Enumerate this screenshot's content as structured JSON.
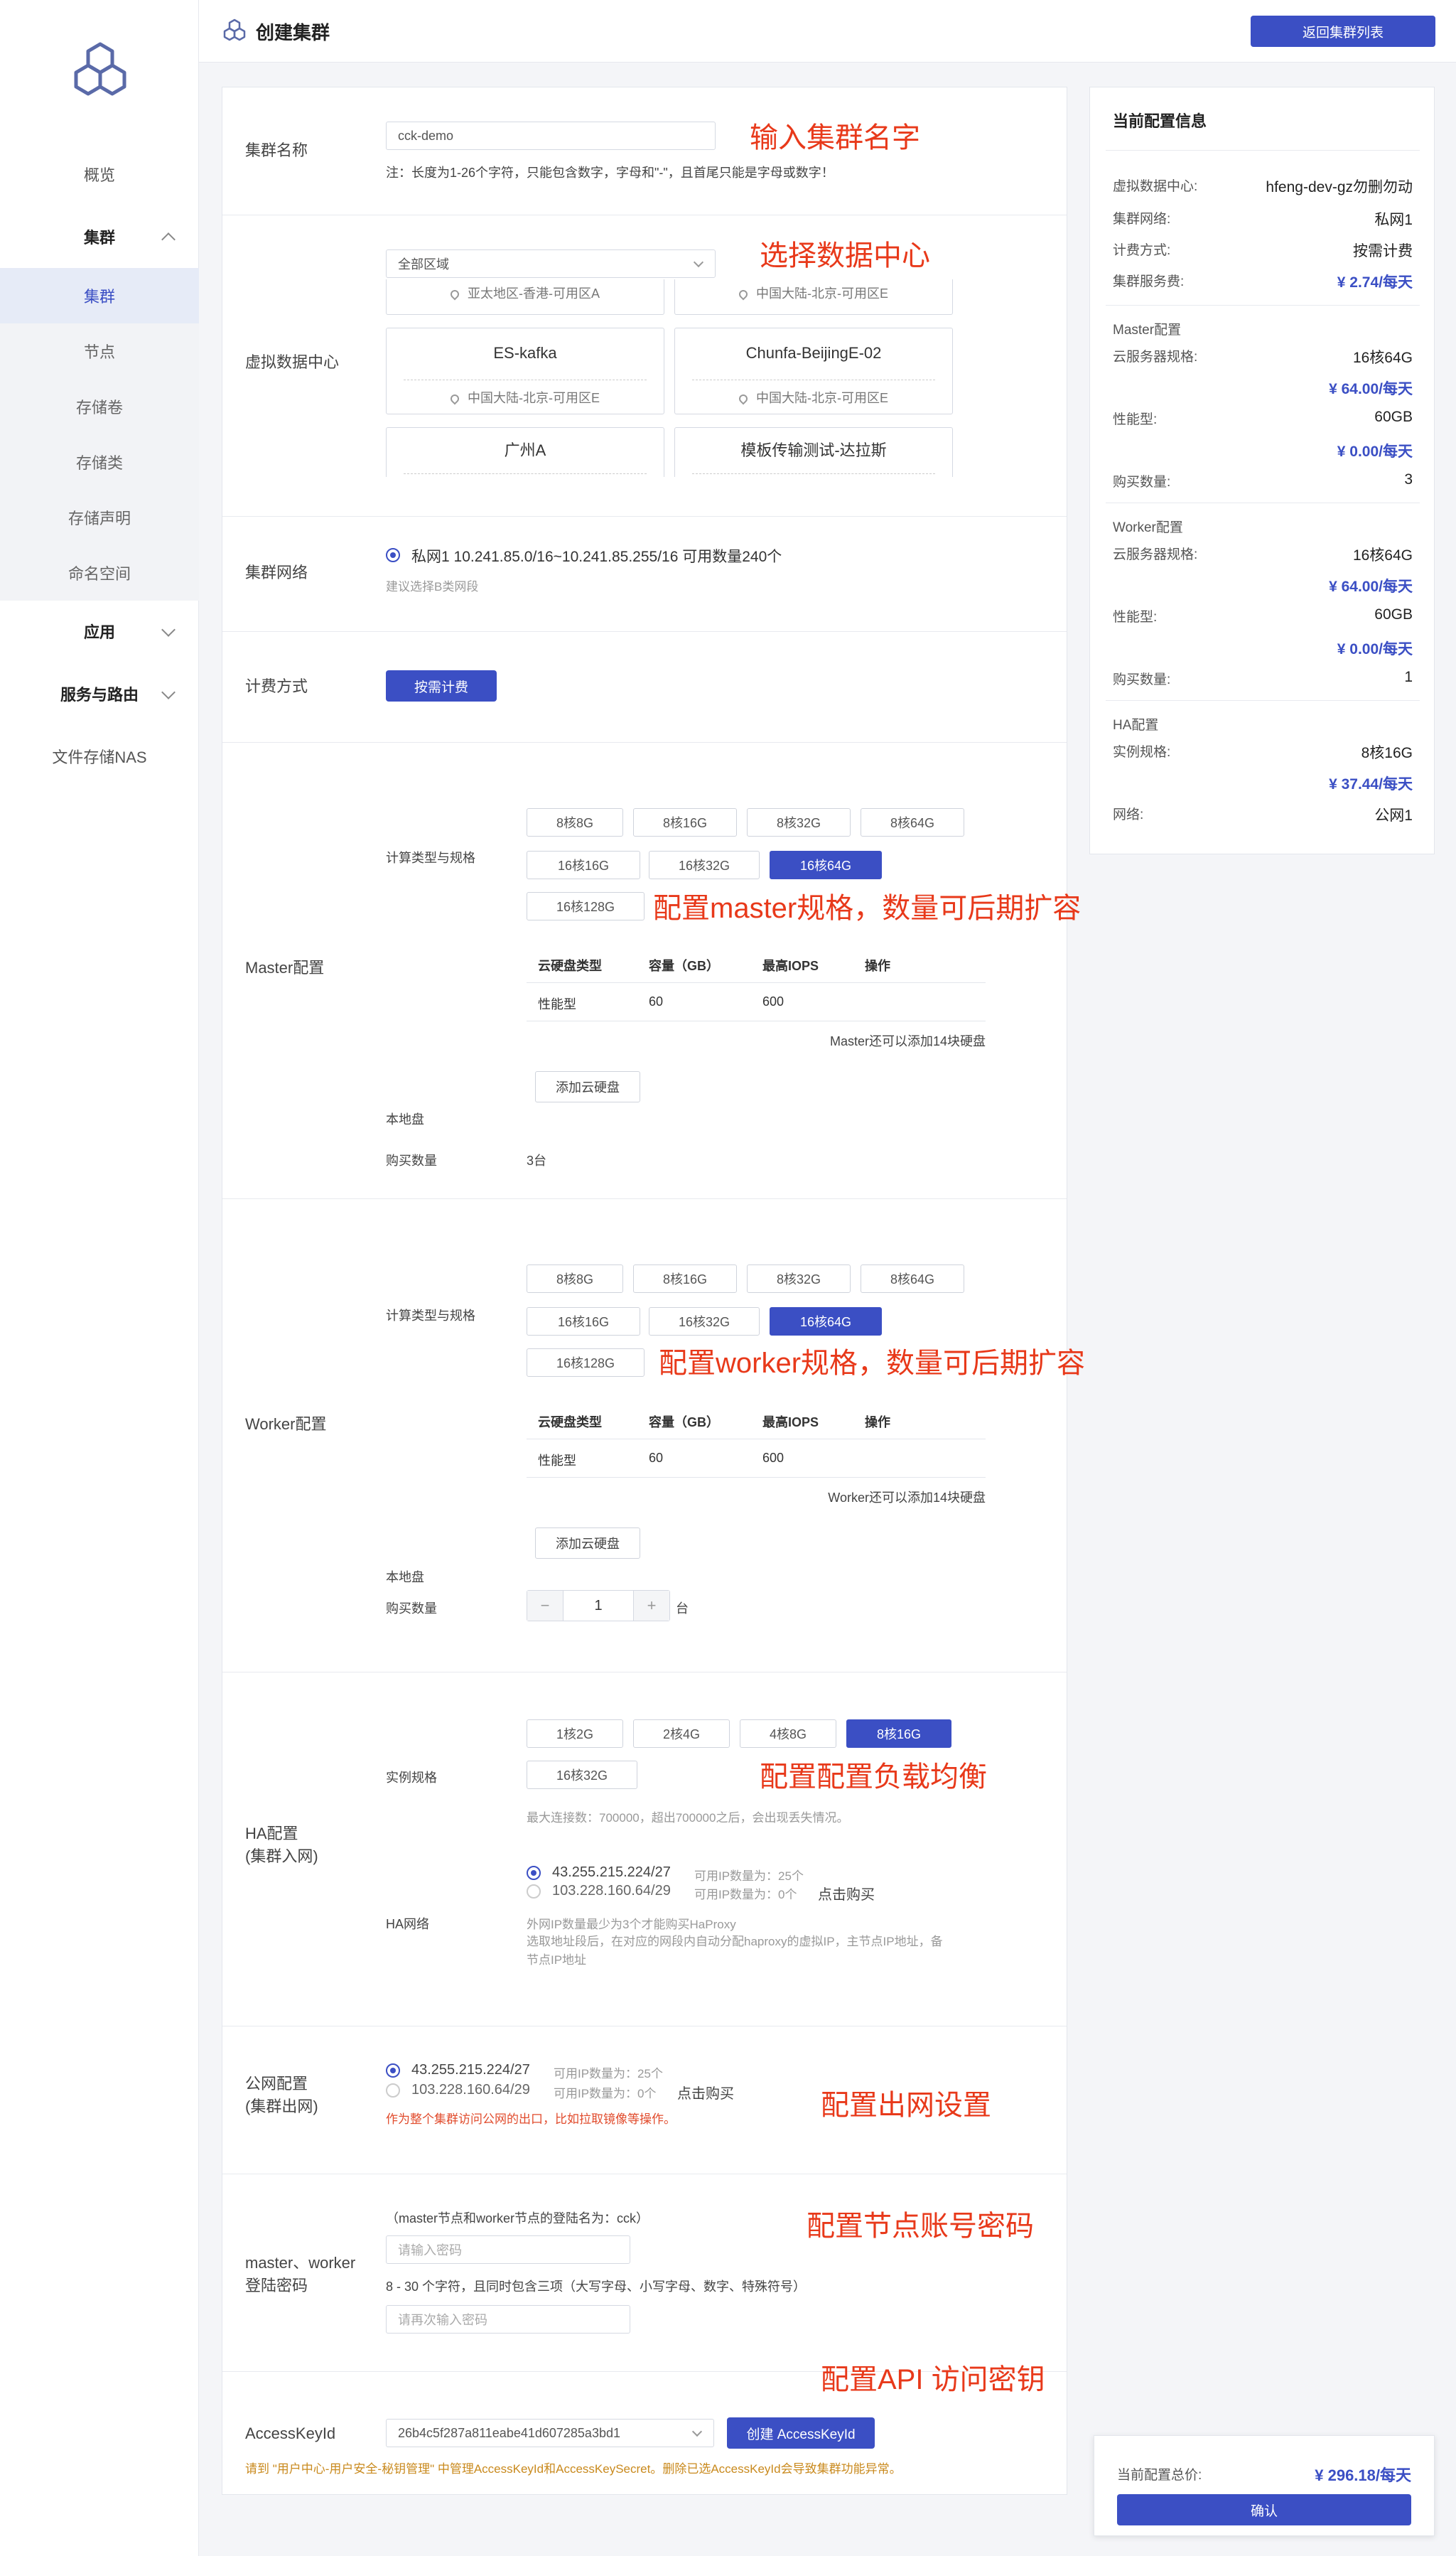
{
  "sidebar": {
    "items": [
      {
        "label": "概览"
      },
      {
        "label": "集群"
      },
      {
        "label": "集群"
      },
      {
        "label": "节点"
      },
      {
        "label": "存储卷"
      },
      {
        "label": "存储类"
      },
      {
        "label": "存储声明"
      },
      {
        "label": "命名空间"
      },
      {
        "label": "应用"
      },
      {
        "label": "服务与路由"
      },
      {
        "label": "文件存储NAS"
      }
    ]
  },
  "header": {
    "title": "创建集群",
    "back_button": "返回集群列表"
  },
  "form": {
    "name": {
      "label": "集群名称",
      "value": "cck-demo",
      "hint": "注：长度为1-26个字符，只能包含数字，字母和\"-\"，且首尾只能是字母或数字！",
      "annotation": "输入集群名字"
    },
    "datacenter": {
      "label": "虚拟数据中心",
      "region_select": "全部区域",
      "annotation": "选择数据中心",
      "partial_top": [
        {
          "location": "亚太地区-香港-可用区A"
        },
        {
          "location": "中国大陆-北京-可用区E"
        }
      ],
      "cards": [
        {
          "name": "ES-kafka",
          "location": "中国大陆-北京-可用区E"
        },
        {
          "name": "Chunfa-BeijingE-02",
          "location": "中国大陆-北京-可用区E"
        }
      ],
      "partial_bottom": [
        {
          "name": "广州A"
        },
        {
          "name": "模板传输测试-达拉斯"
        }
      ]
    },
    "network": {
      "label": "集群网络",
      "option": "私网1   10.241.85.0/16~10.241.85.255/16   可用数量240个",
      "hint": "建议选择B类网段"
    },
    "billing": {
      "label": "计费方式",
      "button": "按需计费"
    },
    "master": {
      "label": "Master配置",
      "spec_label": "计算类型与规格",
      "specs": [
        "8核8G",
        "8核16G",
        "8核32G",
        "8核64G",
        "16核16G",
        "16核32G",
        "16核64G",
        "16核128G"
      ],
      "annotation": "配置master规格，数量可后期扩容",
      "disk_label": "本地盘",
      "disk_headers": [
        "云硬盘类型",
        "容量（GB）",
        "最高IOPS",
        "操作"
      ],
      "disk_row": [
        "性能型",
        "60",
        "600",
        ""
      ],
      "disk_note": "Master还可以添加14块硬盘",
      "add_disk": "添加云硬盘",
      "count_label": "购买数量",
      "count_value": "3台"
    },
    "worker": {
      "label": "Worker配置",
      "spec_label": "计算类型与规格",
      "specs": [
        "8核8G",
        "8核16G",
        "8核32G",
        "8核64G",
        "16核16G",
        "16核32G",
        "16核64G",
        "16核128G"
      ],
      "annotation": "配置worker规格，数量可后期扩容",
      "disk_label": "本地盘",
      "disk_headers": [
        "云硬盘类型",
        "容量（GB）",
        "最高IOPS",
        "操作"
      ],
      "disk_row": [
        "性能型",
        "60",
        "600",
        ""
      ],
      "disk_note": "Worker还可以添加14块硬盘",
      "add_disk": "添加云硬盘",
      "count_label": "购买数量",
      "count_value": "1",
      "count_unit": "台",
      "minus": "−",
      "plus": "+"
    },
    "ha": {
      "label_line1": "HA配置",
      "label_line2": "(集群入网)",
      "spec_label": "实例规格",
      "specs": [
        "1核2G",
        "2核4G",
        "4核8G",
        "8核16G",
        "16核32G"
      ],
      "annotation": "配置配置负载均衡",
      "max_conn": "最大连接数：700000，超出700000之后，会出现丢失情况。",
      "net_label": "HA网络",
      "ip1": "43.255.215.224/27",
      "ip1_avail": "可用IP数量为：25个",
      "ip2": "103.228.160.64/29",
      "ip2_avail": "可用IP数量为：0个",
      "buy": "点击购买",
      "note1": "外网IP数量最少为3个才能购买HaProxy",
      "note2": "选取地址段后，在对应的网段内自动分配haproxy的虚拟IP，主节点IP地址，备节点IP地址"
    },
    "public": {
      "label_line1": "公网配置",
      "label_line2": "(集群出网)",
      "ip1": "43.255.215.224/27",
      "ip1_avail": "可用IP数量为：25个",
      "ip2": "103.228.160.64/29",
      "ip2_avail": "可用IP数量为：0个",
      "buy": "点击购买",
      "note": "作为整个集群访问公网的出口，比如拉取镜像等操作。",
      "annotation": "配置出网设置"
    },
    "password": {
      "label_line1": "master、worker",
      "label_line2": "登陆密码",
      "note": "（master节点和worker节点的登陆名为：cck）",
      "placeholder": "请输入密码",
      "rule": "8 - 30 个字符，且同时包含三项（大写字母、小写字母、数字、特殊符号）",
      "placeholder2": "请再次输入密码",
      "annotation": "配置节点账号密码"
    },
    "accesskey": {
      "label": "AccessKeyId",
      "value": "26b4c5f287a811eabe41d607285a3bd1",
      "button": "创建 AccessKeyId",
      "note": "请到 \"用户中心-用户安全-秘钥管理\" 中管理AccessKeyId和AccessKeySecret。删除已选AccessKeyId会导致集群功能异常。",
      "annotation": "配置API 访问密钥"
    }
  },
  "summary": {
    "title": "当前配置信息",
    "vdc_label": "虚拟数据中心:",
    "vdc_value": "hfeng-dev-gz勿删勿动",
    "net_label": "集群网络:",
    "net_value": "私网1",
    "bill_label": "计费方式:",
    "bill_value": "按需计费",
    "fee_label": "集群服务费:",
    "fee_value": "¥ 2.74/每天",
    "master_title": "Master配置",
    "m_spec_label": "云服务器规格:",
    "m_spec_value": "16核64G",
    "m_spec_price": "¥ 64.00/每天",
    "m_perf_label": "性能型:",
    "m_perf_value": "60GB",
    "m_perf_price": "¥ 0.00/每天",
    "m_count_label": "购买数量:",
    "m_count_value": "3",
    "worker_title": "Worker配置",
    "w_spec_label": "云服务器规格:",
    "w_spec_value": "16核64G",
    "w_spec_price": "¥ 64.00/每天",
    "w_perf_label": "性能型:",
    "w_perf_value": "60GB",
    "w_perf_price": "¥ 0.00/每天",
    "w_count_label": "购买数量:",
    "w_count_value": "1",
    "ha_title": "HA配置",
    "ha_spec_label": "实例规格:",
    "ha_spec_value": "8核16G",
    "ha_spec_price": "¥ 37.44/每天",
    "ha_net_label": "网络:",
    "ha_net_value": "公网1"
  },
  "footer": {
    "total_label": "当前配置总价:",
    "total_value": "¥ 296.18/每天",
    "confirm": "确认"
  },
  "colors": {
    "accent": "#3b4fc4",
    "annotation": "#e8391a"
  }
}
